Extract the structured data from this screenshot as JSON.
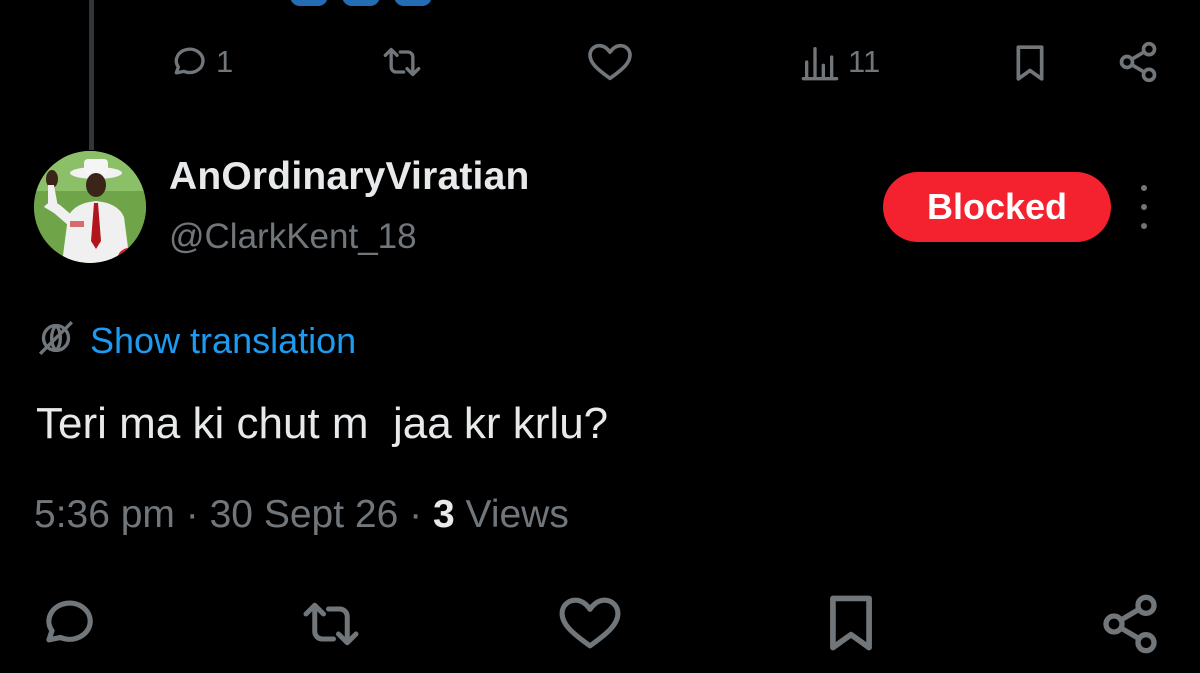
{
  "previous_post": {
    "actions": {
      "reply": {
        "icon": "reply-icon",
        "count": "1"
      },
      "repost": {
        "icon": "repost-icon"
      },
      "like": {
        "icon": "heart-icon"
      },
      "views": {
        "icon": "views-icon",
        "count": "11"
      },
      "bookmark": {
        "icon": "bookmark-icon"
      },
      "share": {
        "icon": "share-icon"
      }
    }
  },
  "post": {
    "author": {
      "name": "AnOrdinaryViratian",
      "handle": "@ClarkKent_18"
    },
    "blocked_label": "Blocked",
    "translate_label": "Show translation",
    "text": "Teri ma ki chut m  jaa kr krlu?",
    "time": "5:36 pm",
    "date": "30 Sept 26",
    "separator": "·",
    "views_count": "3",
    "views_label": "Views"
  },
  "bottom_actions": {
    "reply": {
      "icon": "reply-icon"
    },
    "repost": {
      "icon": "repost-icon"
    },
    "like": {
      "icon": "heart-icon"
    },
    "bookmark": {
      "icon": "bookmark-icon"
    },
    "share": {
      "icon": "share-icon"
    }
  },
  "colors": {
    "background": "#000000",
    "text_primary": "#e7e9ea",
    "text_secondary": "#71767b",
    "link": "#1d9bf0",
    "blocked": "#f4212e"
  }
}
